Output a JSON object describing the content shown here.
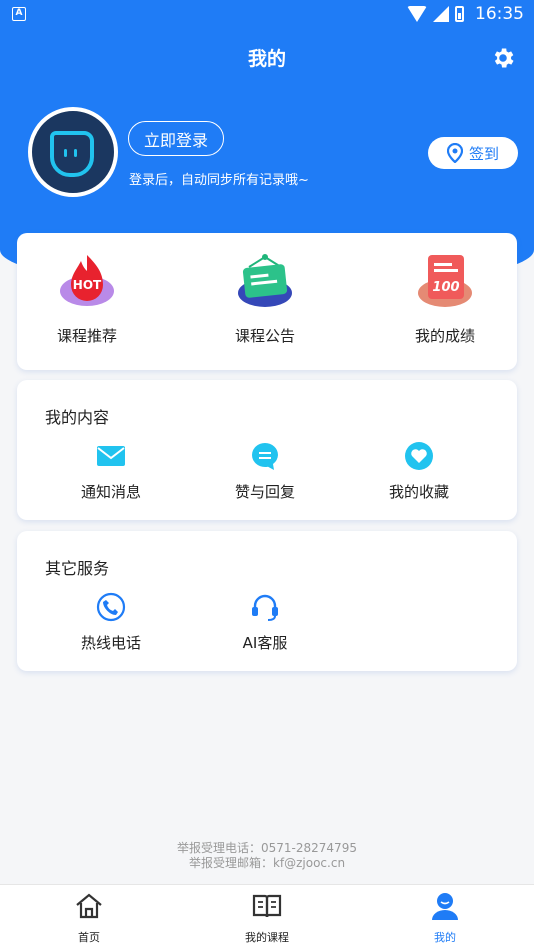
{
  "status_bar": {
    "time": "16:35",
    "app_badge": "A"
  },
  "header": {
    "title": "我的"
  },
  "profile": {
    "login_label": "立即登录",
    "login_hint": "登录后，自动同步所有记录哦~",
    "signin_label": "签到"
  },
  "features": [
    {
      "label": "课程推荐",
      "icon": "hot-icon",
      "badge": "HOT"
    },
    {
      "label": "课程公告",
      "icon": "announcement-board-icon"
    },
    {
      "label": "我的成绩",
      "icon": "score-100-icon",
      "badge": "100"
    }
  ],
  "my_content": {
    "title": "我的内容",
    "items": [
      {
        "label": "通知消息",
        "icon": "envelope-icon"
      },
      {
        "label": "赞与回复",
        "icon": "chat-bubble-icon"
      },
      {
        "label": "我的收藏",
        "icon": "heart-icon"
      }
    ]
  },
  "other_services": {
    "title": "其它服务",
    "items": [
      {
        "label": "热线电话",
        "icon": "phone-icon"
      },
      {
        "label": "AI客服",
        "icon": "headset-icon"
      }
    ]
  },
  "footer": {
    "phone_line": "举报受理电话：0571-28274795",
    "email_line": "举报受理邮箱：kf@zjooc.cn"
  },
  "tabs": [
    {
      "label": "首页",
      "icon": "home-icon",
      "active": false
    },
    {
      "label": "我的课程",
      "icon": "book-icon",
      "active": false
    },
    {
      "label": "我的",
      "icon": "user-icon",
      "active": true
    }
  ],
  "colors": {
    "primary": "#1f7cf6",
    "accent_cyan": "#21c3ef",
    "background": "#f5f6f8"
  }
}
